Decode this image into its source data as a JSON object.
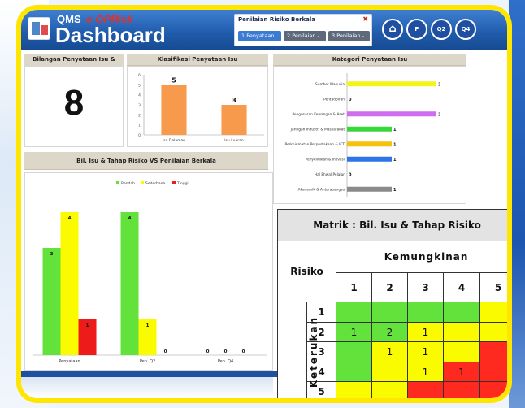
{
  "header": {
    "app_qms": "QMS",
    "app_brand": "e-OPRisk",
    "app_title": "Dashboard",
    "nav_title": "Penilaian Risiko Berkala",
    "nav_close": "✖",
    "tabs": [
      {
        "label": "1.Penyataan..."
      },
      {
        "label": "2.Penilaian - ..."
      },
      {
        "label": "3.Penilaian - ..."
      }
    ],
    "circle_buttons": [
      {
        "label": "⌂",
        "icon": "home-icon"
      },
      {
        "label": "P"
      },
      {
        "label": "Q2"
      },
      {
        "label": "Q4"
      }
    ]
  },
  "panels": {
    "bilangan_title": "Bilangan Penyataan Isu & Risiko",
    "bilangan_value": "8",
    "klasifikasi_title": "Klasifikasi Penyataan Isu",
    "kategori_title": "Kategori Penyataan Isu",
    "bil_tahap_title": "Bil. Isu & Tahap Risiko VS Penilaian Berkala"
  },
  "klasifikasi_chart": {
    "type": "bar",
    "categories": [
      "Isu Dalaman",
      "Isu Luaran"
    ],
    "values": [
      5,
      3
    ],
    "ylim": [
      0,
      6
    ],
    "yticks": [
      "6",
      "5",
      "4",
      "3",
      "2",
      "1",
      "0"
    ],
    "color": "#f79a4b",
    "grid": false
  },
  "kategori_chart": {
    "type": "bar",
    "orientation": "horizontal",
    "categories": [
      "Sumber Manusia",
      "Pentadbiran",
      "Pengurusan Kewangan & Aset",
      "Jaringan Industri & Masyarakat",
      "Perkhidmatan Perpustakaan & ICT",
      "Penyelidikan & Inovasi",
      "Hal Ehwal Pelajar",
      "Akademik & Antarabangsa"
    ],
    "values": [
      2,
      0,
      2,
      1,
      1,
      1,
      0,
      1
    ],
    "colors": [
      "#f4f41a",
      "#f4f41a",
      "#cf6cf0",
      "#39d83a",
      "#f4c20d",
      "#2f74e8",
      "#f4f41a",
      "#8a8a8a"
    ],
    "xlim": [
      0,
      2
    ]
  },
  "chart_data": {
    "type": "bar",
    "categories": [
      "Penyataan",
      "Pen. Q2",
      "Pen. Q4"
    ],
    "series": [
      {
        "name": "Rendah",
        "values": [
          3,
          4,
          0
        ],
        "color": "#63e23c"
      },
      {
        "name": "Sederhana",
        "values": [
          4,
          1,
          0
        ],
        "color": "#fbfb00"
      },
      {
        "name": "Tinggi",
        "values": [
          1,
          0,
          0
        ],
        "color": "#ee1b1b"
      }
    ],
    "ylim": [
      0,
      4.5
    ],
    "legend": "top",
    "grid": false
  },
  "matrix": {
    "title": "Matrik : Bil. Isu & Tahap Risiko",
    "risiko_label": "Risiko",
    "kemungkinan_label": "Kemungkinan",
    "keterukan_label": "Keterukan",
    "col_headers": [
      "1",
      "2",
      "3",
      "4",
      "5"
    ],
    "rows": [
      {
        "label": "1",
        "cells": [
          {
            "v": "",
            "c": "g"
          },
          {
            "v": "",
            "c": "g"
          },
          {
            "v": "",
            "c": "g"
          },
          {
            "v": "",
            "c": "g"
          },
          {
            "v": "",
            "c": "y"
          }
        ]
      },
      {
        "label": "2",
        "cells": [
          {
            "v": "1",
            "c": "g"
          },
          {
            "v": "2",
            "c": "g"
          },
          {
            "v": "1",
            "c": "y"
          },
          {
            "v": "",
            "c": "y"
          },
          {
            "v": "",
            "c": "y"
          }
        ]
      },
      {
        "label": "3",
        "cells": [
          {
            "v": "",
            "c": "g"
          },
          {
            "v": "1",
            "c": "y"
          },
          {
            "v": "1",
            "c": "y"
          },
          {
            "v": "",
            "c": "y"
          },
          {
            "v": "",
            "c": "r"
          }
        ]
      },
      {
        "label": "4",
        "cells": [
          {
            "v": "",
            "c": "g"
          },
          {
            "v": "",
            "c": "y"
          },
          {
            "v": "1",
            "c": "y"
          },
          {
            "v": "1",
            "c": "r"
          },
          {
            "v": "",
            "c": "r"
          }
        ]
      },
      {
        "label": "5",
        "cells": [
          {
            "v": "",
            "c": "y"
          },
          {
            "v": "",
            "c": "y"
          },
          {
            "v": "",
            "c": "r"
          },
          {
            "v": "",
            "c": "r"
          },
          {
            "v": "",
            "c": "r"
          }
        ]
      }
    ]
  }
}
